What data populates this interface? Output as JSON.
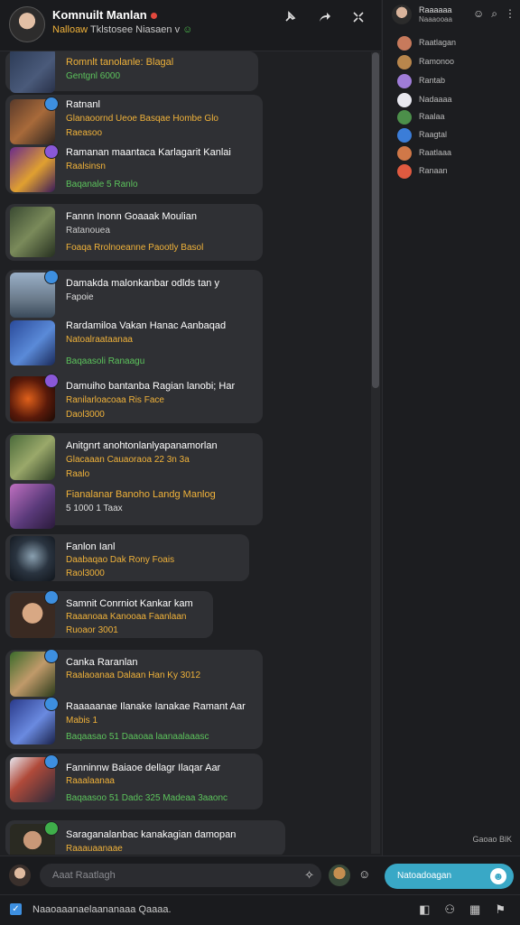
{
  "header": {
    "title": "Komnuilt Manlan",
    "subtitle_1": "Nalloaw",
    "subtitle_2": "Tklstosee Niasaen",
    "subtitle_3": "v"
  },
  "chat": [
    {
      "title": "Romnlt tanolanle: Blagal",
      "line2": "",
      "line3": "Gentgnl 6000"
    },
    {
      "title": "Ratnanl",
      "line2": "Glanaoornd Ueoe Basqae Hombe Glo",
      "line3": "Raeasoo"
    },
    {
      "title": "Ramanan maantaca Karlagarit Kanlai",
      "line2": "Raalsinsn",
      "line3": "Baqanale 5 Ranlo"
    },
    {
      "title": "Fannn Inonn Goaaak Moulian",
      "line2": "Ratanouea",
      "line3": "Foaqa Rrolnoeanne Paootly Basol"
    },
    {
      "title": "Damakda malonkanbar odlds tan y",
      "line2": "Fapoie",
      "line3": ""
    },
    {
      "title": "Rardamiloa Vakan Hanac Aanbaqad",
      "line2": "Natoalraataanaa",
      "line3": "Baqaasoli Ranaagu"
    },
    {
      "title": "Damuiho bantanba Ragian lanobi; Har",
      "line2": "Ranilarloacoaa Ris Face",
      "line3": "Daol3000"
    },
    {
      "title": "Anitgnrt anohtonlanlyapanamorlan",
      "line2": "Glacaaan Cauaoraoa 22 3n 3a",
      "line3": "Raalo"
    },
    {
      "title": "Fianalanar Banoho Landg Manlog",
      "line2": "5 1000  1 Taax",
      "line3": ""
    },
    {
      "title": "Fanlon Ianl",
      "line2": "Daabaqao Dak Rony Foais",
      "line3": "Raol3000"
    },
    {
      "title": "Samnit Conrniot Kankar kam",
      "line2": "Raaanoaa Kanooaa Faanlaan",
      "line3": "Ruoaor 3001"
    },
    {
      "title": "Canka Raranlan",
      "line2": "Raalaoanaa Dalaan Han Ky 3012",
      "line3": ""
    },
    {
      "title": "Raaaaanae Ilanake Ianakae Ramant Aar",
      "line2": "Mabis 1",
      "line3": "Baqaasao 51 Daaoaa laanaalaaasc"
    },
    {
      "title": "Fanninnw Baiaoe dellagr Ilaqar Aar",
      "line2": "Raaalaanaa",
      "line3": "Baqaasoo 51 Dadc 325 Madeaa 3aaonc"
    },
    {
      "title": "Saraganalanbac kanakagian damopan",
      "line2": "Raaauaanaae",
      "line3": ""
    }
  ],
  "members": {
    "title": "Raaaaaa",
    "subtitle": "Naaaooaa",
    "list": [
      {
        "name": "Raatlagan",
        "color": "#c77a5c"
      },
      {
        "name": "Ramonoo",
        "color": "#b8864c"
      },
      {
        "name": "Rantab",
        "color": "#9f7cd8"
      },
      {
        "name": "Nadaaaa",
        "color": "#e8e8ef"
      },
      {
        "name": "Raalaa",
        "color": "#4c8f4a"
      },
      {
        "name": "Raagtal",
        "color": "#3b7dd8"
      },
      {
        "name": "Raatlaaa",
        "color": "#d07848"
      },
      {
        "name": "Ranaan",
        "color": "#e05a40"
      }
    ],
    "status": "Gaoao BlK"
  },
  "input": {
    "placeholder": "Aaat Raatlagh",
    "send_label": "Natoadoagan"
  },
  "footer": {
    "text": "Naaoaaanaelaananaaa Qaaaa."
  }
}
